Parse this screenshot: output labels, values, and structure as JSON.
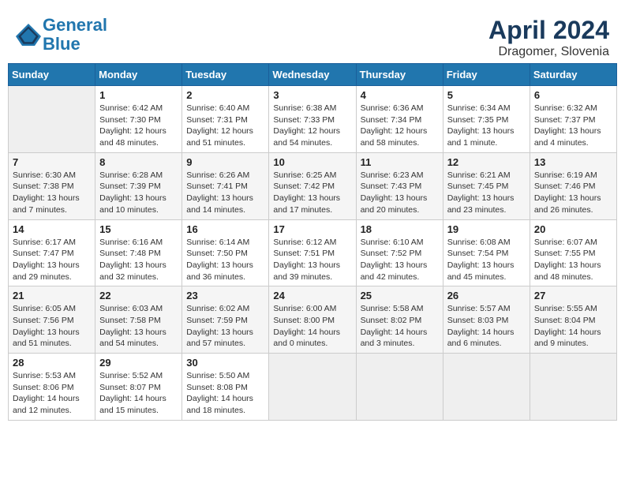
{
  "header": {
    "logo_line1": "General",
    "logo_line2": "Blue",
    "month": "April 2024",
    "location": "Dragomer, Slovenia"
  },
  "days_of_week": [
    "Sunday",
    "Monday",
    "Tuesday",
    "Wednesday",
    "Thursday",
    "Friday",
    "Saturday"
  ],
  "weeks": [
    [
      {
        "day": "",
        "empty": true
      },
      {
        "day": "1",
        "sunrise": "Sunrise: 6:42 AM",
        "sunset": "Sunset: 7:30 PM",
        "daylight": "Daylight: 12 hours and 48 minutes."
      },
      {
        "day": "2",
        "sunrise": "Sunrise: 6:40 AM",
        "sunset": "Sunset: 7:31 PM",
        "daylight": "Daylight: 12 hours and 51 minutes."
      },
      {
        "day": "3",
        "sunrise": "Sunrise: 6:38 AM",
        "sunset": "Sunset: 7:33 PM",
        "daylight": "Daylight: 12 hours and 54 minutes."
      },
      {
        "day": "4",
        "sunrise": "Sunrise: 6:36 AM",
        "sunset": "Sunset: 7:34 PM",
        "daylight": "Daylight: 12 hours and 58 minutes."
      },
      {
        "day": "5",
        "sunrise": "Sunrise: 6:34 AM",
        "sunset": "Sunset: 7:35 PM",
        "daylight": "Daylight: 13 hours and 1 minute."
      },
      {
        "day": "6",
        "sunrise": "Sunrise: 6:32 AM",
        "sunset": "Sunset: 7:37 PM",
        "daylight": "Daylight: 13 hours and 4 minutes."
      }
    ],
    [
      {
        "day": "7",
        "sunrise": "Sunrise: 6:30 AM",
        "sunset": "Sunset: 7:38 PM",
        "daylight": "Daylight: 13 hours and 7 minutes."
      },
      {
        "day": "8",
        "sunrise": "Sunrise: 6:28 AM",
        "sunset": "Sunset: 7:39 PM",
        "daylight": "Daylight: 13 hours and 10 minutes."
      },
      {
        "day": "9",
        "sunrise": "Sunrise: 6:26 AM",
        "sunset": "Sunset: 7:41 PM",
        "daylight": "Daylight: 13 hours and 14 minutes."
      },
      {
        "day": "10",
        "sunrise": "Sunrise: 6:25 AM",
        "sunset": "Sunset: 7:42 PM",
        "daylight": "Daylight: 13 hours and 17 minutes."
      },
      {
        "day": "11",
        "sunrise": "Sunrise: 6:23 AM",
        "sunset": "Sunset: 7:43 PM",
        "daylight": "Daylight: 13 hours and 20 minutes."
      },
      {
        "day": "12",
        "sunrise": "Sunrise: 6:21 AM",
        "sunset": "Sunset: 7:45 PM",
        "daylight": "Daylight: 13 hours and 23 minutes."
      },
      {
        "day": "13",
        "sunrise": "Sunrise: 6:19 AM",
        "sunset": "Sunset: 7:46 PM",
        "daylight": "Daylight: 13 hours and 26 minutes."
      }
    ],
    [
      {
        "day": "14",
        "sunrise": "Sunrise: 6:17 AM",
        "sunset": "Sunset: 7:47 PM",
        "daylight": "Daylight: 13 hours and 29 minutes."
      },
      {
        "day": "15",
        "sunrise": "Sunrise: 6:16 AM",
        "sunset": "Sunset: 7:48 PM",
        "daylight": "Daylight: 13 hours and 32 minutes."
      },
      {
        "day": "16",
        "sunrise": "Sunrise: 6:14 AM",
        "sunset": "Sunset: 7:50 PM",
        "daylight": "Daylight: 13 hours and 36 minutes."
      },
      {
        "day": "17",
        "sunrise": "Sunrise: 6:12 AM",
        "sunset": "Sunset: 7:51 PM",
        "daylight": "Daylight: 13 hours and 39 minutes."
      },
      {
        "day": "18",
        "sunrise": "Sunrise: 6:10 AM",
        "sunset": "Sunset: 7:52 PM",
        "daylight": "Daylight: 13 hours and 42 minutes."
      },
      {
        "day": "19",
        "sunrise": "Sunrise: 6:08 AM",
        "sunset": "Sunset: 7:54 PM",
        "daylight": "Daylight: 13 hours and 45 minutes."
      },
      {
        "day": "20",
        "sunrise": "Sunrise: 6:07 AM",
        "sunset": "Sunset: 7:55 PM",
        "daylight": "Daylight: 13 hours and 48 minutes."
      }
    ],
    [
      {
        "day": "21",
        "sunrise": "Sunrise: 6:05 AM",
        "sunset": "Sunset: 7:56 PM",
        "daylight": "Daylight: 13 hours and 51 minutes."
      },
      {
        "day": "22",
        "sunrise": "Sunrise: 6:03 AM",
        "sunset": "Sunset: 7:58 PM",
        "daylight": "Daylight: 13 hours and 54 minutes."
      },
      {
        "day": "23",
        "sunrise": "Sunrise: 6:02 AM",
        "sunset": "Sunset: 7:59 PM",
        "daylight": "Daylight: 13 hours and 57 minutes."
      },
      {
        "day": "24",
        "sunrise": "Sunrise: 6:00 AM",
        "sunset": "Sunset: 8:00 PM",
        "daylight": "Daylight: 14 hours and 0 minutes."
      },
      {
        "day": "25",
        "sunrise": "Sunrise: 5:58 AM",
        "sunset": "Sunset: 8:02 PM",
        "daylight": "Daylight: 14 hours and 3 minutes."
      },
      {
        "day": "26",
        "sunrise": "Sunrise: 5:57 AM",
        "sunset": "Sunset: 8:03 PM",
        "daylight": "Daylight: 14 hours and 6 minutes."
      },
      {
        "day": "27",
        "sunrise": "Sunrise: 5:55 AM",
        "sunset": "Sunset: 8:04 PM",
        "daylight": "Daylight: 14 hours and 9 minutes."
      }
    ],
    [
      {
        "day": "28",
        "sunrise": "Sunrise: 5:53 AM",
        "sunset": "Sunset: 8:06 PM",
        "daylight": "Daylight: 14 hours and 12 minutes."
      },
      {
        "day": "29",
        "sunrise": "Sunrise: 5:52 AM",
        "sunset": "Sunset: 8:07 PM",
        "daylight": "Daylight: 14 hours and 15 minutes."
      },
      {
        "day": "30",
        "sunrise": "Sunrise: 5:50 AM",
        "sunset": "Sunset: 8:08 PM",
        "daylight": "Daylight: 14 hours and 18 minutes."
      },
      {
        "day": "",
        "empty": true
      },
      {
        "day": "",
        "empty": true
      },
      {
        "day": "",
        "empty": true
      },
      {
        "day": "",
        "empty": true
      }
    ]
  ]
}
